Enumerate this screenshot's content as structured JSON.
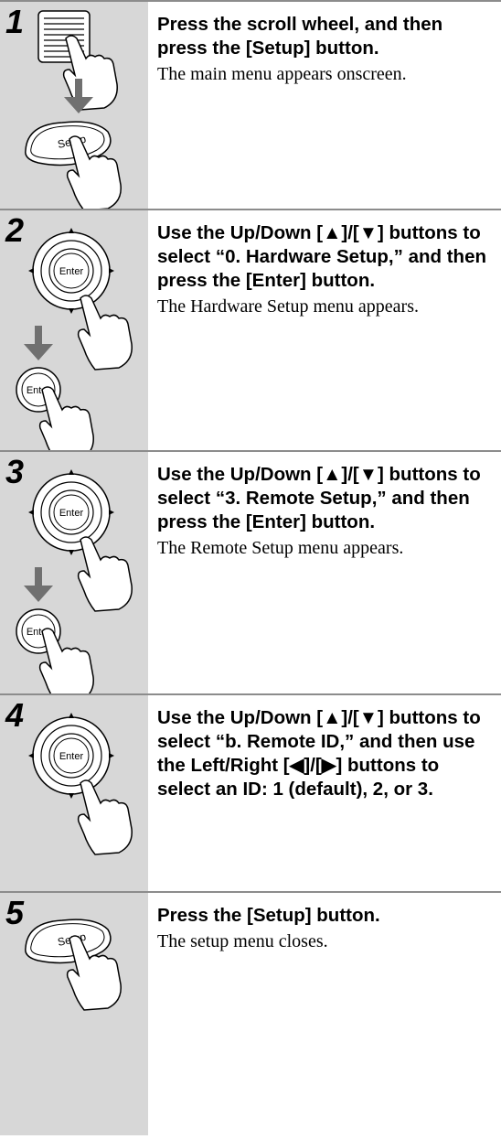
{
  "steps": [
    {
      "number": "1",
      "instruction": "Press the scroll wheel, and then press the [Setup] button.",
      "result": "The main menu appears onscreen.",
      "button_labels": [
        "Setup"
      ]
    },
    {
      "number": "2",
      "instruction": "Use the Up/Down [▲]/[▼] buttons to select “0. Hardware Setup,” and then press the [Enter] button.",
      "result": "The Hardware Setup menu appears.",
      "button_labels": [
        "Enter",
        "Enter"
      ]
    },
    {
      "number": "3",
      "instruction": "Use the Up/Down [▲]/[▼] buttons to select “3. Remote Setup,” and then press the [Enter] button.",
      "result": "The Remote Setup menu appears.",
      "button_labels": [
        "Enter",
        "Enter"
      ]
    },
    {
      "number": "4",
      "instruction": "Use the Up/Down [▲]/[▼] buttons to select “b. Remote ID,” and then use the Left/Right [◀]/[▶] buttons to select an ID: 1 (default), 2, or 3.",
      "result": "",
      "button_labels": [
        "Enter"
      ]
    },
    {
      "number": "5",
      "instruction": "Press the [Setup] button.",
      "result": "The setup menu closes.",
      "button_labels": [
        "Setup"
      ]
    }
  ]
}
